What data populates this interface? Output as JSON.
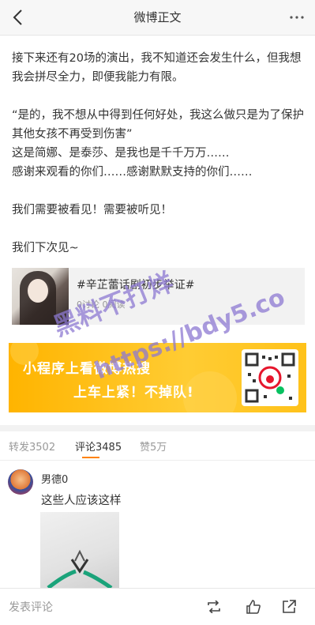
{
  "header": {
    "title": "微博正文",
    "back_icon": "chevron-left-icon",
    "more_icon": "ellipsis-icon"
  },
  "post": {
    "para1": "接下来还有20场的演出，我不知道还会发生什么，但我想我会拼尽全力，即便我能力有限。",
    "para2a": "“是的，我不想从中得到任何好处，我这么做只是为了保护其他女孩不再受到伤害”",
    "para2b": "这是简娜、是泰莎、是我也是千千万万……",
    "para2c": "感谢来观看的你们……感谢默默支持的你们……",
    "para3": "我们需要被看见！需要被听见！",
    "para4": "我们下次见~"
  },
  "topic_card": {
    "title": "#辛芷蕾话剧初步举证#",
    "meta": "0讨论 0阅读"
  },
  "banner": {
    "line1": "小程序上看微博热搜",
    "line2": "上车上紧！不掉队!"
  },
  "watermark": {
    "line1": "黑料不打烊",
    "line2": "https://bdy5.co"
  },
  "tabs": {
    "repost": "转发3502",
    "comment": "评论3485",
    "like": "赞5万"
  },
  "comment": {
    "user": "男德0",
    "text": "这些人应该这样"
  },
  "bottom": {
    "placeholder": "发表评论",
    "icons": [
      "repost-icon",
      "like-icon",
      "share-icon"
    ]
  },
  "colors": {
    "accent": "#ff8200",
    "banner": "#ffbe1a",
    "watermark": "#8c78d2"
  }
}
